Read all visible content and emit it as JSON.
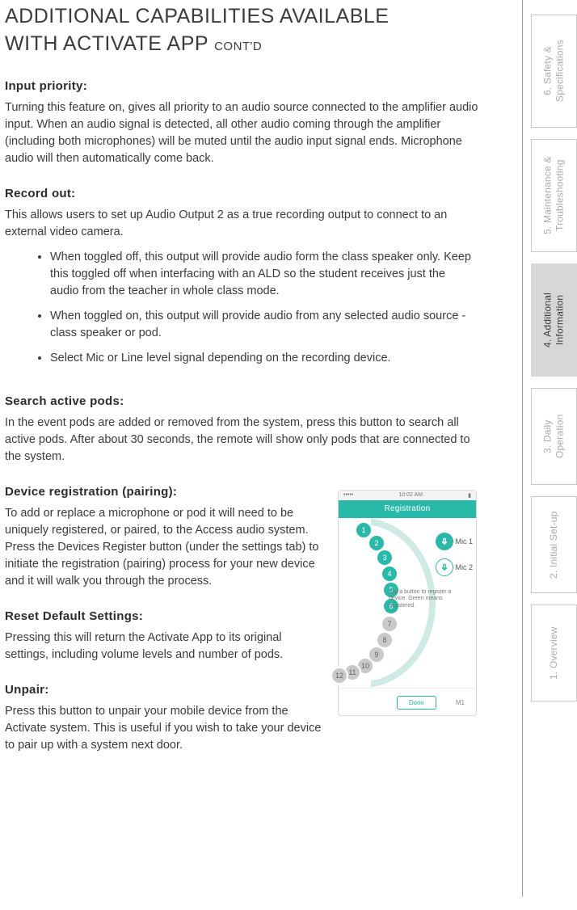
{
  "heading": {
    "line1": "ADDITIONAL CAPABILITIES AVAILABLE",
    "line2_main": "WITH ACTIVATE APP",
    "line2_suffix": "CONT'D"
  },
  "sections": {
    "input_priority": {
      "label": "Input priority:",
      "body": "Turning this feature on, gives all priority to an audio source connected to the amplifier audio input. When an audio signal is detected, all other audio coming through the amplifier (including both microphones) will be muted until the audio input signal ends. Microphone audio will then automatically come back."
    },
    "record_out": {
      "label": "Record out:",
      "intro": "This allows users to set up Audio Output 2 as a true recording output to connect to an external video camera.",
      "bullets": [
        "When toggled off, this output will provide audio form the class speaker only. Keep this toggled off when interfacing with an ALD so the student receives just the audio from the teacher in whole class mode.",
        "When toggled on, this output will provide audio from any selected audio source - class speaker or pod.",
        "Select Mic or Line level signal depending on the recording device."
      ]
    },
    "search_pods": {
      "label": "Search active pods:",
      "body": "In the event pods are added or removed from the system, press this button to search all active pods. After about 30 seconds, the remote will show only pods that are connected to the system."
    },
    "device_reg": {
      "label": "Device registration (pairing):",
      "body": "To add or replace a microphone or pod it will need to be uniquely registered, or paired, to the Access audio system. Press the Devices Register button (under the settings tab) to initiate the registration (pairing) process for your new device and it will walk you through the process."
    },
    "reset": {
      "label": "Reset Default Settings:",
      "body": "Pressing this will return the Activate App to its original settings, including volume levels and number of pods."
    },
    "unpair": {
      "label": "Unpair:",
      "body": "Press this button to unpair your mobile device from the Activate system. This is useful if you wish to take your device to pair up with a system next door."
    }
  },
  "phone": {
    "time": "10:02 AM",
    "title": "Registration",
    "mic1": "Mic 1",
    "mic2": "Mic 2",
    "tip": "Tap a button to register a device. Green means registered.",
    "done": "Done",
    "wifi": "M1",
    "nodes": [
      "1",
      "2",
      "3",
      "4",
      "5",
      "6",
      "7",
      "8",
      "9",
      "10",
      "11",
      "12"
    ]
  },
  "tabs": {
    "t6": "6. Safety & Specifications",
    "t5": "5. Maintenance & Troubleshooting",
    "t4": "4. Additional Information",
    "t3": "3. Daily Operation",
    "t2": "2. Initial Set-up",
    "t1": "1. Overview"
  }
}
